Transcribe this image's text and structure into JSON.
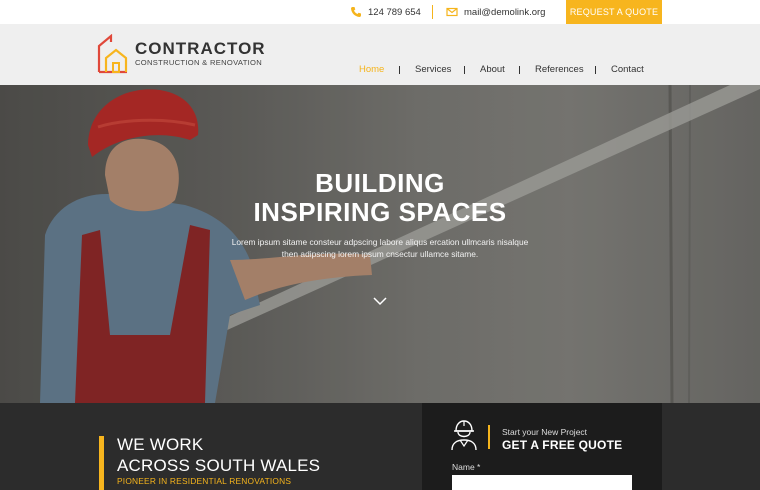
{
  "topbar": {
    "phone": "124 789 654",
    "email": "mail@demolink.org",
    "quote_button": "REQUEST A QUOTE"
  },
  "logo": {
    "title": "CONTRACTOR",
    "subtitle": "CONSTRUCTION & RENOVATION"
  },
  "nav": {
    "items": [
      {
        "label": "Home",
        "active": true
      },
      {
        "label": "Services",
        "active": false
      },
      {
        "label": "About",
        "active": false
      },
      {
        "label": "References",
        "active": false
      },
      {
        "label": "Contact",
        "active": false
      }
    ]
  },
  "hero": {
    "title_line1": "BUILDING",
    "title_line2": "INSPIRING SPACES",
    "text_line1": "Lorem ipsum sitame consteur adpscing labore aliqus ercation ullmcaris nisalque",
    "text_line2": "then adipscing lorem ipsum cnsectur ullamce sitame."
  },
  "about": {
    "title_line1": "WE WORK",
    "title_line2": "ACROSS SOUTH WALES",
    "tagline": "PIONEER IN RESIDENTIAL RENOVATIONS"
  },
  "quote_form": {
    "kicker": "Start your New Project",
    "title": "GET A FREE QUOTE",
    "name_label": "Name *",
    "name_value": ""
  },
  "colors": {
    "accent": "#f7b51e",
    "logo_red": "#e0483a",
    "dark": "#2c2c2c",
    "panel": "#1c1c1c"
  },
  "icons": {
    "phone": "phone-icon",
    "mail": "mail-icon",
    "scroll": "chevron-down-icon",
    "worker": "worker-icon",
    "logo": "house-logo-icon"
  }
}
